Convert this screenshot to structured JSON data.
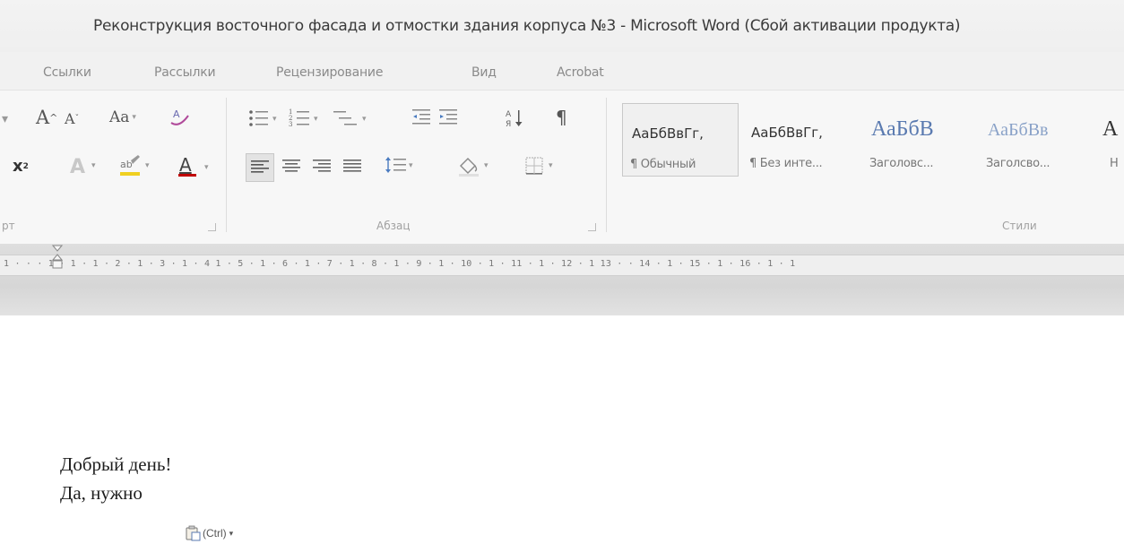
{
  "window": {
    "title": "Реконструкция восточного фасада и отмостки здания корпуса №3  -  Microsoft Word (Сбой активации продукта)"
  },
  "tabs": [
    "Ссылки",
    "Рассылки",
    "Рецензирование",
    "Вид",
    "Acrobat"
  ],
  "ribbon": {
    "font_group": {
      "label": "рт",
      "grow_font": "A",
      "shrink_font": "A",
      "change_case": "Aa",
      "superscript": "x",
      "font_color_letter": "A"
    },
    "paragraph_group": {
      "label": "Абзац",
      "pilcrow": "¶"
    },
    "styles_group": {
      "label": "Стили",
      "styles": [
        {
          "sample": "АаБбВвГг,",
          "name": "¶ Обычный",
          "selected": true
        },
        {
          "sample": "АаБбВвГг,",
          "name": "¶ Без инте...",
          "selected": false
        },
        {
          "sample": "АаБбВ",
          "name": "Заголовс...",
          "selected": false
        },
        {
          "sample": "АаБбВв",
          "name": "Заголсво...",
          "selected": false
        },
        {
          "sample": "А",
          "name": "Н",
          "selected": false
        }
      ]
    }
  },
  "ruler": {
    "text": "1 · · · 1 · 1 · 1 · 2 · 1 · 3 · 1 · 4   1 · 5 · 1 · 6 · 1 · 7 · 1 · 8 · 1 · 9 · 1 · 10 · 1 · 11 · 1 · 12 · 1   13 ·   · 14 · 1 · 15 · 1 · 16 · 1 · 1"
  },
  "document": {
    "lines": [
      "Добрый день!",
      "Да, нужно"
    ]
  },
  "paste_options": {
    "label": "(Ctrl)",
    "arrow": "▾"
  },
  "colors": {
    "font_color_underline": "#c00000",
    "highlight": "#f0d020"
  }
}
